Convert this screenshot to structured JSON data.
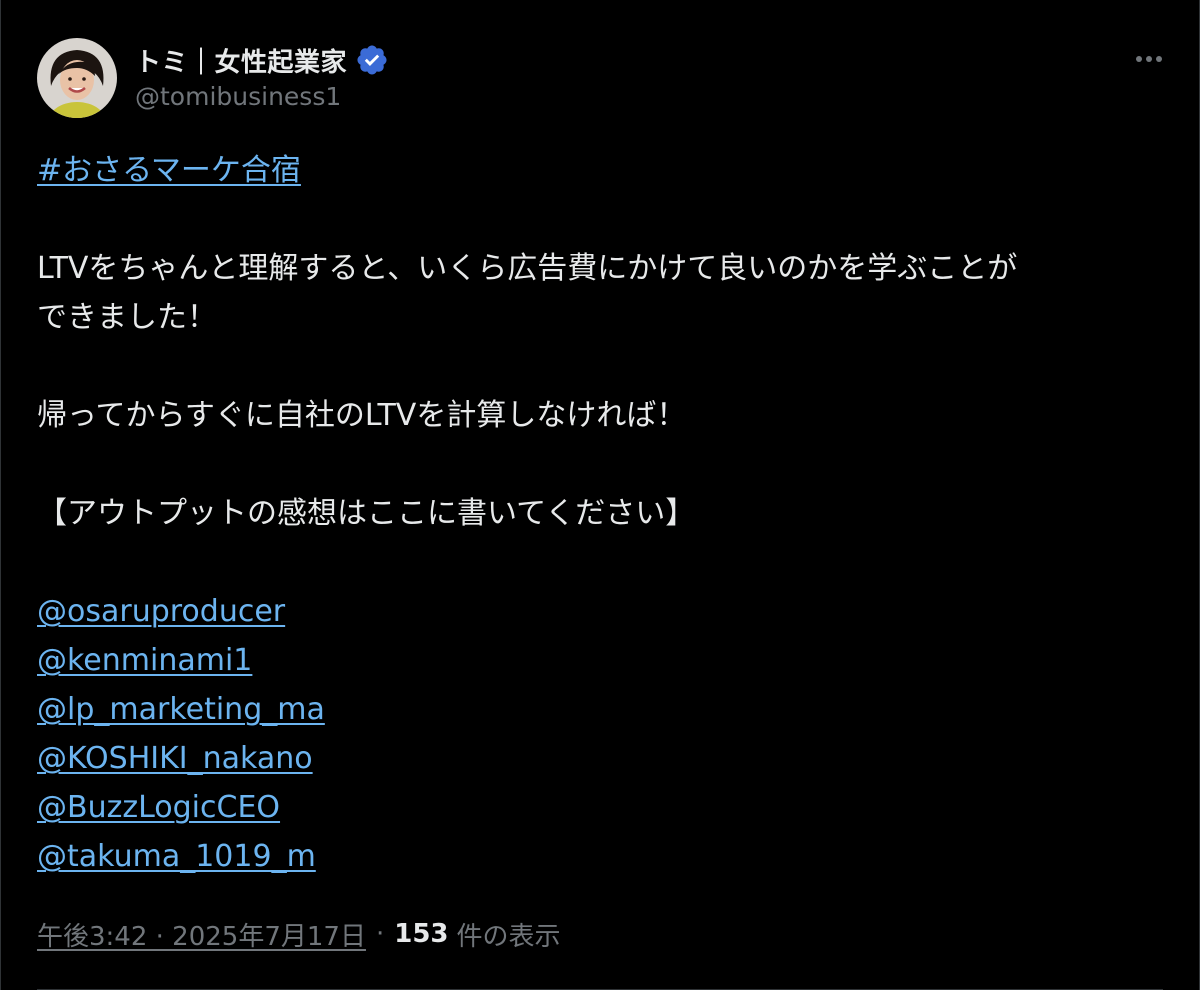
{
  "author": {
    "display_name": "トミ｜女性起業家",
    "handle": "@tomibusiness1",
    "verified": true,
    "verified_color": "#3b6bd6"
  },
  "more_icon": "more-horizontal-icon",
  "tweet": {
    "hashtag": "#おさるマーケ合宿",
    "line1": "LTVをちゃんと理解すると、いくら広告費にかけて良いのかを学ぶことが",
    "line2": "できました！",
    "line3": "帰ってからすぐに自社のLTVを計算しなければ！",
    "line4": "【アウトプットの感想はここに書いてください】",
    "mentions": [
      "@osaruproducer",
      "@kenminami1",
      "@lp_marketing_ma",
      "@KOSHIKI_nakano",
      "@BuzzLogicCEO",
      "@takuma_1019_m"
    ]
  },
  "meta": {
    "timestamp": "午後3:42 · 2025年7月17日",
    "separator": "·",
    "views_count": "153",
    "views_label": "件の表示"
  },
  "colors": {
    "background": "#000000",
    "text": "#e7e9ea",
    "secondary": "#71767b",
    "link": "#6cb4f0",
    "border": "#2f3336"
  }
}
